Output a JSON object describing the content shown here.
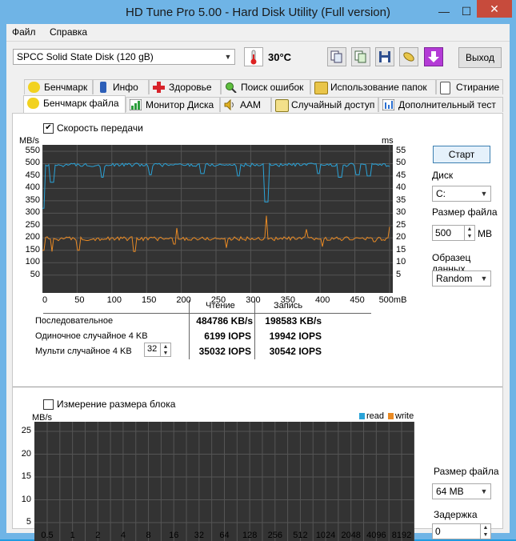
{
  "window": {
    "title": "HD Tune Pro 5.00 - Hard Disk Utility (Full  version)",
    "min_glyph": "—",
    "max_glyph": "☐",
    "close_glyph": "✕"
  },
  "menu": {
    "file": "Файл",
    "help": "Справка"
  },
  "toolbar": {
    "disk": "SPCC Solid State Disk (120 gB)",
    "temperature": "30°C",
    "exit_label": "Выход"
  },
  "tabs_row1": [
    {
      "label": "Бенчмарк",
      "icon": "benchmark-icon"
    },
    {
      "label": "Инфо",
      "icon": "info-icon"
    },
    {
      "label": "Здоровье",
      "icon": "health-icon"
    },
    {
      "label": "Поиск ошибок",
      "icon": "error-scan-icon"
    },
    {
      "label": "Использование папок",
      "icon": "folder-usage-icon"
    },
    {
      "label": "Стирание",
      "icon": "erase-icon"
    }
  ],
  "tabs_row2": [
    {
      "label": "Бенчмарк файла",
      "icon": "file-benchmark-icon"
    },
    {
      "label": "Монитор Диска",
      "icon": "disk-monitor-icon"
    },
    {
      "label": "AAM",
      "icon": "aam-icon"
    },
    {
      "label": "Случайный доступ",
      "icon": "random-access-icon"
    },
    {
      "label": "Дополнительный  тест",
      "icon": "extra-test-icon"
    }
  ],
  "benchmark": {
    "transfer_checkbox": "Скорость передачи",
    "transfer_checked": true,
    "unit_left": "MB/s",
    "unit_right": "ms",
    "y_left": [
      "550",
      "500",
      "450",
      "400",
      "350",
      "300",
      "250",
      "200",
      "150",
      "100",
      "50"
    ],
    "y_right": [
      "55",
      "50",
      "45",
      "40",
      "35",
      "30",
      "25",
      "20",
      "15",
      "10",
      "5"
    ],
    "x_ticks": [
      "0",
      "50",
      "100",
      "150",
      "200",
      "250",
      "300",
      "350",
      "400",
      "450",
      "500mB"
    ],
    "colors": {
      "read": "#2aa3d8",
      "write": "#e98a24",
      "background": "#333333",
      "grid": "#555555"
    }
  },
  "results": {
    "col_read": "Чтение",
    "col_write": "Запись",
    "rows": [
      {
        "label": "Последовательное",
        "read": "484786 KB/s",
        "write": "198583 KB/s"
      },
      {
        "label": "Одиночное случайное 4 KB",
        "read": "6199 IOPS",
        "write": "19942 IOPS"
      },
      {
        "label": "Мульти случайное 4 KB",
        "read": "35032 IOPS",
        "write": "30542 IOPS"
      }
    ],
    "queue_depth": "32"
  },
  "side": {
    "start_label": "Старт",
    "disk_label": "Диск",
    "disk_value": "C:",
    "file_size_label": "Размер файла",
    "file_size_value": "500",
    "file_size_unit": "MB",
    "pattern_label": "Образец данных",
    "pattern_value": "Random"
  },
  "block": {
    "checkbox": "Измерение размера блока",
    "checked": false,
    "unit": "MB/s",
    "legend_read": "read",
    "legend_write": "write",
    "y_labels": [
      "25",
      "20",
      "15",
      "10",
      "5"
    ],
    "x_labels": [
      "0.5",
      "1",
      "2",
      "4",
      "8",
      "16",
      "32",
      "64",
      "128",
      "256",
      "512",
      "1024",
      "2048",
      "4096",
      "8192"
    ],
    "file_size_label": "Размер файла",
    "file_size_value": "64 MB",
    "delay_label": "Задержка",
    "delay_value": "0"
  }
}
